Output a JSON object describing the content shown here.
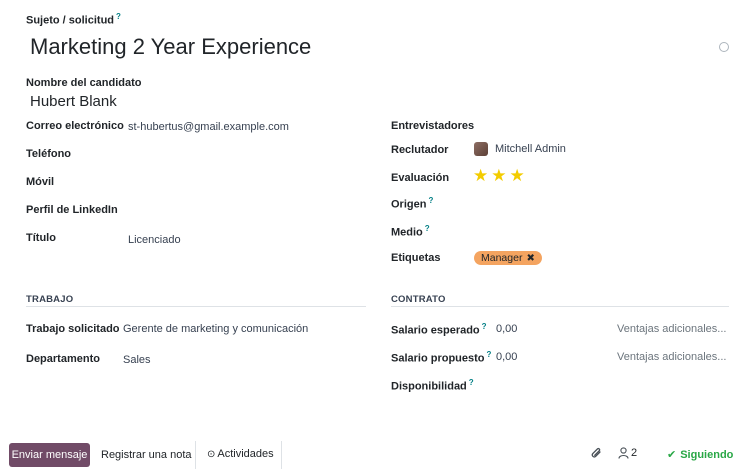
{
  "header": {
    "subject_label": "Sujeto / solicitud",
    "subject_help": "?",
    "title": "Marketing 2 Year Experience"
  },
  "candidate": {
    "label": "Nombre del candidato",
    "name": "Hubert Blank"
  },
  "left_fields": {
    "email_label": "Correo electrónico",
    "email_value": "st-hubertus@gmail.example.com",
    "phone_label": "Teléfono",
    "mobile_label": "Móvil",
    "linkedin_label": "Perfil de LinkedIn",
    "degree_label": "Título",
    "degree_value": "Licenciado"
  },
  "right_fields": {
    "interviewers_label": "Entrevistadores",
    "recruiter_label": "Reclutador",
    "recruiter_value": "Mitchell Admin",
    "evaluation_label": "Evaluación",
    "evaluation_stars": 3,
    "source_label": "Origen",
    "source_help": "?",
    "medium_label": "Medio",
    "medium_help": "?",
    "tags_label": "Etiquetas",
    "tags": [
      "Manager"
    ]
  },
  "job_section": {
    "title": "TRABAJO",
    "applied_job_label": "Trabajo solicitado",
    "applied_job_value": "Gerente de marketing y comunicación",
    "department_label": "Departamento",
    "department_value": "Sales"
  },
  "contract_section": {
    "title": "CONTRATO",
    "expected_salary_label": "Salario esperado",
    "expected_salary_help": "?",
    "expected_salary_value": "0,00",
    "expected_extra": "Ventajas adicionales...",
    "proposed_salary_label": "Salario propuesto",
    "proposed_salary_help": "?",
    "proposed_salary_value": "0,00",
    "proposed_extra": "Ventajas adicionales...",
    "availability_label": "Disponibilidad",
    "availability_help": "?"
  },
  "chatter": {
    "send_message": "Enviar mensaje",
    "log_note": "Registrar una nota",
    "activities": "Actividades",
    "followers_count": "2",
    "following": "Siguiendo"
  },
  "colors": {
    "primary": "#714b67",
    "help": "#017e84",
    "star": "#f3cc00",
    "tag": "#f4a460",
    "following": "#28a745"
  }
}
